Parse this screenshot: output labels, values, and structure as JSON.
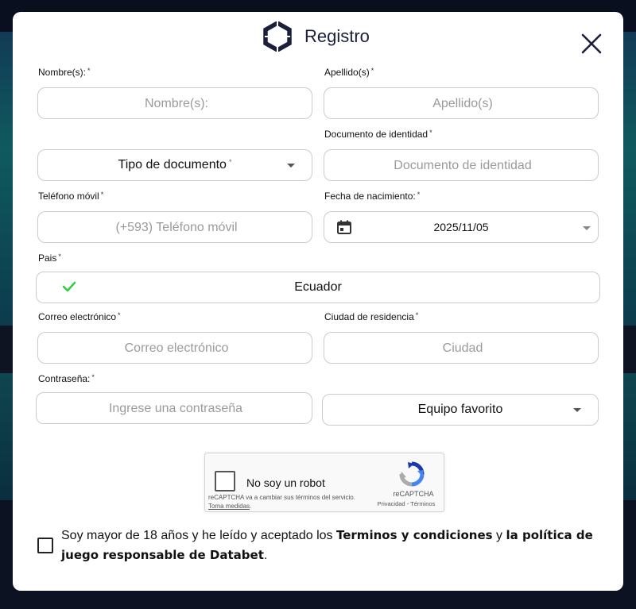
{
  "modal": {
    "title": "Registro",
    "close_icon": "close-icon",
    "logo_icon": "hexagon-logo-icon"
  },
  "form": {
    "nombre": {
      "label": "Nombre(s):",
      "required": "*",
      "placeholder": "Nombre(s):",
      "value": ""
    },
    "apellido": {
      "label": "Apellido(s)",
      "required": "*",
      "placeholder": "Apellido(s)",
      "value": ""
    },
    "tipo_documento": {
      "label": "Tipo de documento",
      "required": "*",
      "icon": "caret-down-icon"
    },
    "documento": {
      "label": "Documento de identidad",
      "required": "*",
      "placeholder": "Documento de identidad",
      "value": ""
    },
    "telefono": {
      "label": "Teléfono móvil",
      "required": "*",
      "placeholder": "(+593) Teléfono móvil",
      "value": ""
    },
    "fecha_nacimiento": {
      "label": "Fecha de nacimiento:",
      "required": "*",
      "value": "2025/11/05",
      "icon": "calendar-icon"
    },
    "pais": {
      "label": "Pais",
      "required": "*",
      "value": "Ecuador",
      "icon": "check-icon",
      "icon_color": "#2ecc40"
    },
    "correo": {
      "label": "Correo electrónico",
      "required": "*",
      "placeholder": "Correo electrónico",
      "value": ""
    },
    "ciudad": {
      "label": "Ciudad de residencia",
      "required": "*",
      "placeholder": "Ciudad",
      "value": ""
    },
    "contrasena": {
      "label": "Contraseña:",
      "required": "*",
      "placeholder": "Ingrese una contraseña",
      "value": ""
    },
    "equipo": {
      "value": "Equipo favorito",
      "icon": "caret-down-icon"
    }
  },
  "captcha": {
    "label": "No soy un robot",
    "notice": "reCAPTCHA va a cambiar sus términos del servicio.",
    "notice_link": "Toma medidas",
    "brand": "reCAPTCHA",
    "privacy": "Privacidad",
    "separator": " - ",
    "terms": "Términos",
    "icon": "recaptcha-icon"
  },
  "terms": {
    "text_before": "Soy mayor de 18 años y he leído y aceptado los ",
    "link1": "Terminos y condiciones",
    "text_middle": " y ",
    "link2": "la política de juego responsable de Databet",
    "text_after": "."
  },
  "colors": {
    "brand_dark": "#1b1f3b",
    "field_border": "#c9cbcf",
    "placeholder": "#9a9a9a",
    "check_green": "#2ecc40"
  }
}
